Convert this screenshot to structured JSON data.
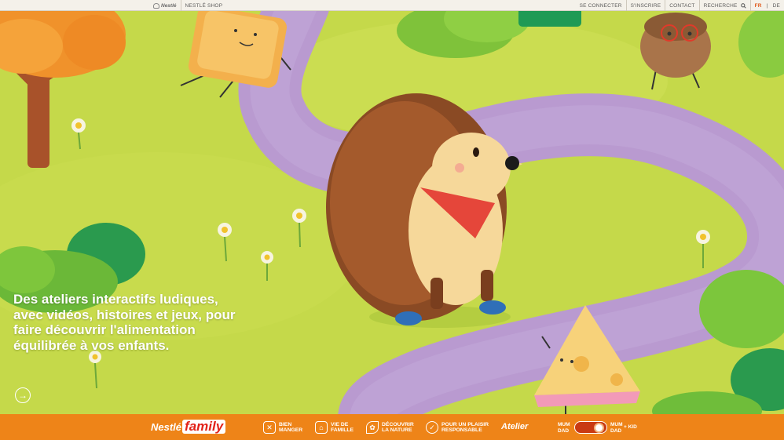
{
  "topbar": {
    "logo_text": "Nestlé",
    "shop_label": "NESTLÉ SHOP",
    "links": [
      "SE CONNECTER",
      "S'INSCRIRE",
      "CONTACT",
      "RECHERCHE"
    ],
    "search_icon": "search-icon",
    "lang_fr": "FR",
    "lang_sep": "|",
    "lang_de": "DE"
  },
  "hero": {
    "text": "Des ateliers interactifs ludiques, avec vidéos, histoires et jeux, pour faire découvrir l'alimentation équilibrée à vos enfants.",
    "arrow_icon": "arrow-right-icon"
  },
  "bottombar": {
    "brand_part1": "Nestlé",
    "brand_part2": "family",
    "nav": [
      {
        "label": "BIEN MANGER",
        "icon": "cutlery-icon"
      },
      {
        "label": "VIE DE FAMILLE",
        "icon": "house-icon"
      },
      {
        "label": "DÉCOUVRIR LA NATURE",
        "icon": "leaf-icon"
      },
      {
        "label": "POUR UN PLAISIR RESPONSABLE",
        "icon": "check-icon"
      }
    ],
    "atelier": "Atelier",
    "mode_left": "MUM DAD",
    "mode_right": "MUM DAD",
    "kid_label": "+ KID"
  },
  "colors": {
    "grass": "#c5d94a",
    "path": "#b99ad0",
    "bar_orange": "#ee8418",
    "accent_red": "#e2231a"
  }
}
